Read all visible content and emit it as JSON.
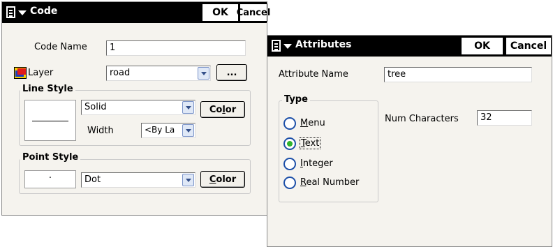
{
  "code_dialog": {
    "title": "Code",
    "ok_label": "OK",
    "cancel_label": "Cancel",
    "code_name_label": "Code Name",
    "code_name_value": "1",
    "layer_label": "Layer",
    "layer_value": "road",
    "browse_label": "...",
    "line_style": {
      "group_label": "Line Style",
      "style_value": "Solid",
      "color_label_pre": "Co",
      "color_label_acc": "l",
      "color_label_post": "or",
      "width_label": "Width",
      "width_value": "<By La"
    },
    "point_style": {
      "group_label": "Point Style",
      "preview_char": "·",
      "style_value": "Dot",
      "color_label_acc": "C",
      "color_label_post": "olor"
    }
  },
  "attributes_dialog": {
    "title": "Attributes",
    "ok_label": "OK",
    "cancel_label": "Cancel",
    "attribute_name_label": "Attribute Name",
    "attribute_name_value": "tree",
    "type_group_label": "Type",
    "type_options": [
      {
        "acc": "M",
        "rest": "enu",
        "selected": false
      },
      {
        "acc": "T",
        "rest": "ext",
        "selected": true
      },
      {
        "acc": "I",
        "rest": "nteger",
        "selected": false
      },
      {
        "acc": "R",
        "rest": "eal Number",
        "selected": false
      }
    ],
    "num_characters_label": "Num Characters",
    "num_characters_value": "32"
  },
  "colors": {
    "titlebar": "#000000",
    "dialog_bg": "#f5f3ee",
    "radio_selected": "#2fb32f",
    "radio_border": "#1c4fa8",
    "dropdown_button": "#dfe8f7"
  }
}
